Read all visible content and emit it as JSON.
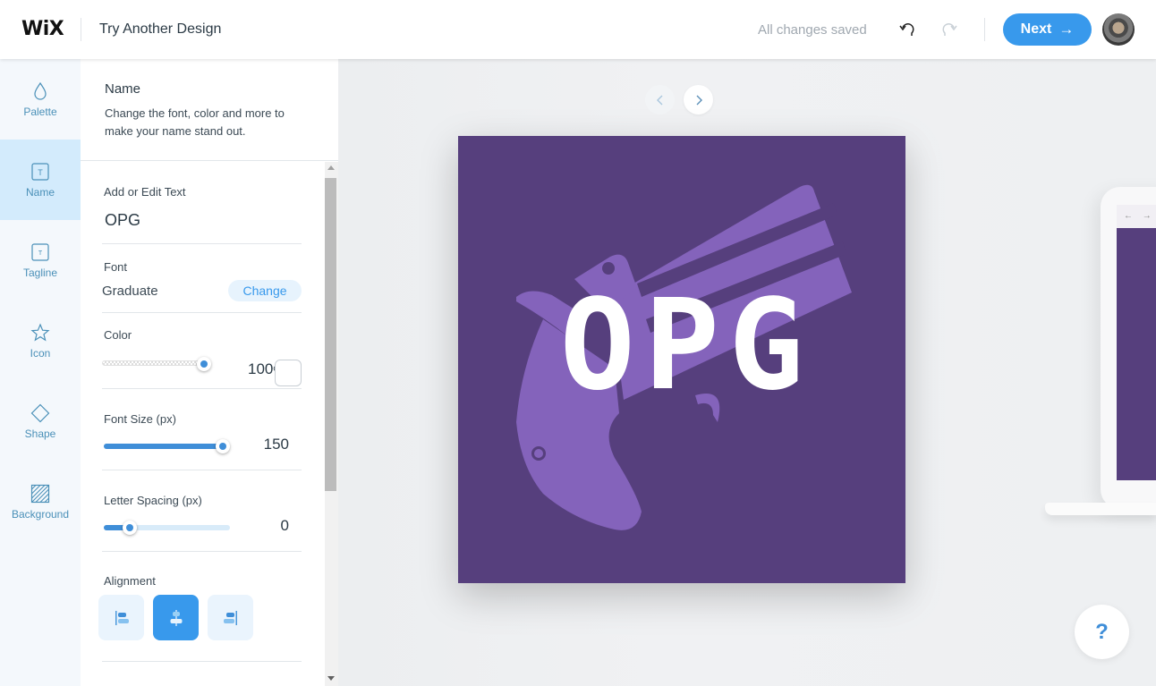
{
  "header": {
    "logo": "WiX",
    "title": "Try Another Design",
    "save_status": "All changes saved",
    "undo_icon": "undo-icon",
    "redo_icon": "redo-icon",
    "next_label": "Next",
    "next_arrow": "→",
    "avatar": "user-avatar"
  },
  "nav": {
    "items": [
      {
        "label": "Palette",
        "icon": "droplet-icon",
        "active": false
      },
      {
        "label": "Name",
        "icon": "text-box-icon",
        "active": true
      },
      {
        "label": "Tagline",
        "icon": "text-box-small-icon",
        "active": false
      },
      {
        "label": "Icon",
        "icon": "star-icon",
        "active": false
      },
      {
        "label": "Shape",
        "icon": "diamond-icon",
        "active": false
      },
      {
        "label": "Background",
        "icon": "hatched-square-icon",
        "active": false
      }
    ]
  },
  "panel": {
    "title": "Name",
    "description": "Change the font, color and more to make your name stand out.",
    "text_section": {
      "label": "Add or Edit Text",
      "value": "OPG"
    },
    "font_section": {
      "label": "Font",
      "value": "Graduate",
      "change_label": "Change"
    },
    "color_section": {
      "label": "Color",
      "opacity": "100",
      "opacity_unit": "%",
      "opacity_fraction": 1.0,
      "swatch_color": "#ffffff"
    },
    "font_size_section": {
      "label": "Font Size (px)",
      "value": "150",
      "slider_fraction": 0.97
    },
    "letter_spacing_section": {
      "label": "Letter Spacing (px)",
      "value": "0",
      "slider_fraction": 0.2
    },
    "alignment_section": {
      "label": "Alignment",
      "options": [
        {
          "name": "align-left",
          "active": false
        },
        {
          "name": "align-center",
          "active": true
        },
        {
          "name": "align-right",
          "active": false
        }
      ]
    }
  },
  "canvas": {
    "prev_icon": "chevron-left-icon",
    "next_icon": "chevron-right-icon",
    "logo_text": "OPG",
    "logo_bg_color": "#563f7d",
    "logo_icon_color": "#8463bb",
    "logo_icon": "derringer-pistol-icon",
    "laptop_bar_icons": "← → C",
    "help_label": "?"
  },
  "colors": {
    "accent": "#3899ec",
    "nav_text": "#4a90b8",
    "nav_active_bg": "#d3ebfc"
  }
}
